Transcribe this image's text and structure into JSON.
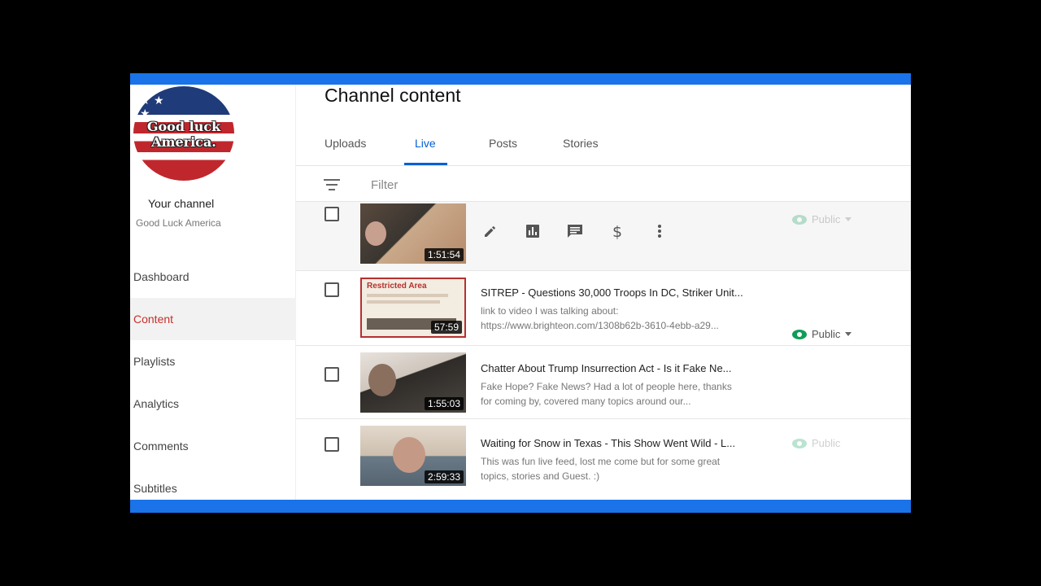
{
  "sidebar": {
    "avatar_text": "Good luck America.",
    "your_channel": "Your channel",
    "channel_name": "Good Luck America",
    "nav": [
      "Dashboard",
      "Content",
      "Playlists",
      "Analytics",
      "Comments",
      "Subtitles"
    ],
    "active_nav": "Content"
  },
  "main": {
    "title": "Channel content",
    "tabs": [
      "Uploads",
      "Live",
      "Posts",
      "Stories"
    ],
    "active_tab": "Live",
    "filter_placeholder": "Filter"
  },
  "videos": [
    {
      "duration": "1:51:54",
      "visibility": "Public"
    },
    {
      "duration": "57:59",
      "title": "SITREP - Questions 30,000 Troops In DC, Striker Unit...",
      "desc1": "link to video I was talking about:",
      "desc2": "https://www.brighteon.com/1308b62b-3610-4ebb-a29...",
      "visibility": "Public",
      "thumb_label": "Restricted Area"
    },
    {
      "duration": "1:55:03",
      "title": "Chatter About Trump Insurrection Act - Is it Fake Ne...",
      "desc1": "Fake Hope? Fake News? Had a lot of people here, thanks",
      "desc2": "for coming by, covered many topics around our..."
    },
    {
      "duration": "2:59:33",
      "title": "Waiting for Snow in Texas - This Show Went Wild - L...",
      "desc1": "This was fun live feed, lost me come but for some great",
      "desc2": "topics, stories and Guest. :)",
      "visibility": "Public"
    }
  ],
  "colors": {
    "accent": "#1a73e8",
    "active_nav": "#c4302b",
    "active_tab": "#065fd4",
    "public_icon": "#0f9d58"
  }
}
